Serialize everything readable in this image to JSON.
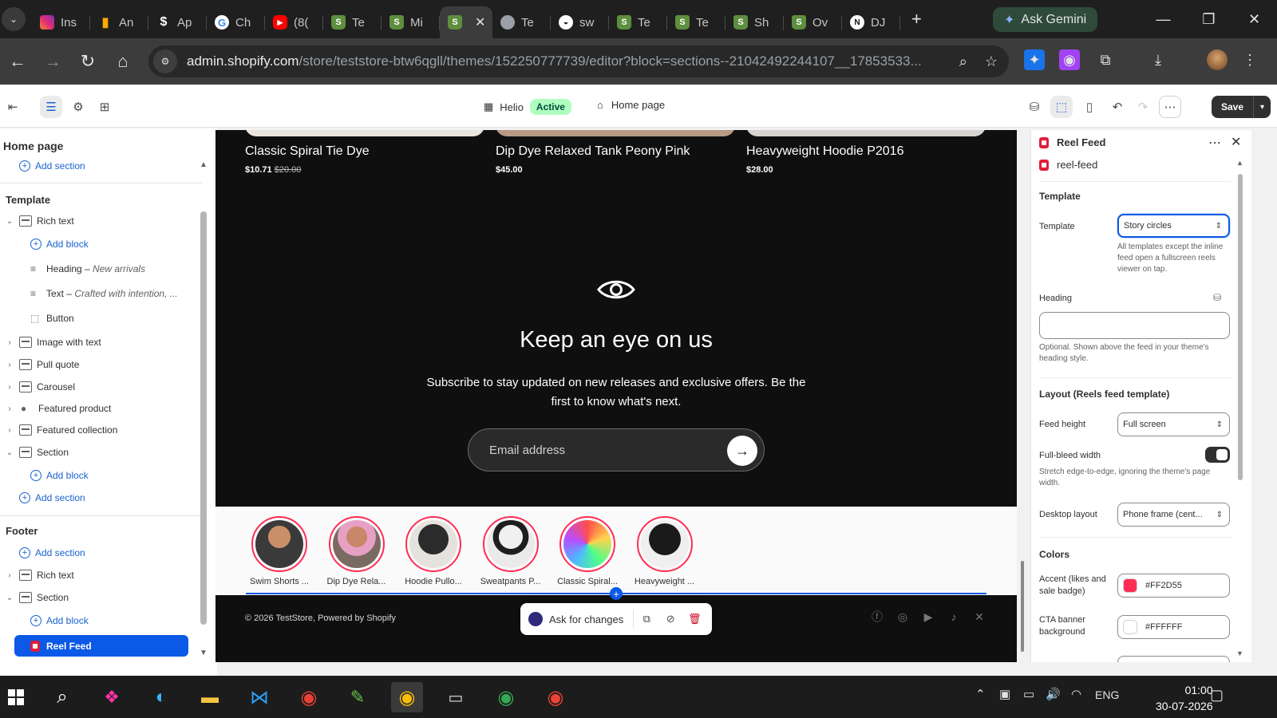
{
  "browser": {
    "tabs": [
      {
        "label": "Ins",
        "icon": "instagram-icon"
      },
      {
        "label": "An",
        "icon": "analytics-icon"
      },
      {
        "label": "Ap",
        "icon": "apps-icon"
      },
      {
        "label": "Ch",
        "icon": "google-icon"
      },
      {
        "label": "(8(",
        "icon": "youtube-icon"
      },
      {
        "label": "Te",
        "icon": "shopify-icon"
      },
      {
        "label": "Mi",
        "icon": "shopify-icon"
      },
      {
        "label": "",
        "icon": "shopify-icon",
        "active": true
      },
      {
        "label": "Te",
        "icon": "globe-icon"
      },
      {
        "label": "sw",
        "icon": "swirl-icon"
      },
      {
        "label": "Te",
        "icon": "shopify-icon"
      },
      {
        "label": "Te",
        "icon": "shopify-icon"
      },
      {
        "label": "Sh",
        "icon": "shopify-icon"
      },
      {
        "label": "Ov",
        "icon": "shopify-icon"
      },
      {
        "label": "DJ",
        "icon": "dj-icon"
      }
    ],
    "gemini_label": "Ask Gemini",
    "url_host": "admin.shopify.com",
    "url_path": "/store/teststore-btw6qgll/themes/152250777739/editor?block=sections--21042492244107__17853533..."
  },
  "editor": {
    "theme_name": "Helio",
    "theme_status": "Active",
    "page_selector": "Home page",
    "save_label": "Save"
  },
  "sidebar": {
    "title": "Home page",
    "add_section_top": "Add section",
    "template_title": "Template",
    "template_items": [
      {
        "label": "Rich text",
        "indent": 0,
        "kind": "section",
        "expanded": true
      },
      {
        "label": "Add block",
        "indent": 1,
        "kind": "add"
      },
      {
        "label": "Heading",
        "detail": "New arrivals",
        "indent": 1,
        "kind": "block"
      },
      {
        "label": "Text",
        "detail": "Crafted with intention, ...",
        "indent": 1,
        "kind": "block"
      },
      {
        "label": "Button",
        "indent": 1,
        "kind": "button"
      },
      {
        "label": "Image with text",
        "indent": 0,
        "kind": "section"
      },
      {
        "label": "Pull quote",
        "indent": 0,
        "kind": "section"
      },
      {
        "label": "Carousel",
        "indent": 0,
        "kind": "section"
      },
      {
        "label": "Featured product",
        "indent": 0,
        "kind": "product"
      },
      {
        "label": "Featured collection",
        "indent": 0,
        "kind": "section"
      },
      {
        "label": "Section",
        "indent": 0,
        "kind": "section",
        "expanded": true
      },
      {
        "label": "Add block",
        "indent": 1,
        "kind": "add"
      },
      {
        "label": "Add section",
        "indent": 0,
        "kind": "add"
      }
    ],
    "footer_title": "Footer",
    "footer_items": [
      {
        "label": "Add section",
        "indent": 0,
        "kind": "add"
      },
      {
        "label": "Rich text",
        "indent": 0,
        "kind": "section"
      },
      {
        "label": "Section",
        "indent": 0,
        "kind": "section",
        "expanded": true
      },
      {
        "label": "Add block",
        "indent": 1,
        "kind": "add"
      }
    ],
    "selected_item": "Reel Feed"
  },
  "preview": {
    "products": [
      {
        "title": "Classic Spiral Tie Dye",
        "price": "$10.71",
        "compare_price": "$20.00"
      },
      {
        "title": "Dip Dye Relaxed Tank Peony Pink",
        "price": "$45.00",
        "compare_price": ""
      },
      {
        "title": "Heavyweight Hoodie P2016",
        "price": "$28.00",
        "compare_price": ""
      }
    ],
    "newsletter_title": "Keep an eye on us",
    "newsletter_text": "Subscribe to stay updated on new releases and exclusive offers. Be the first to know what's next.",
    "email_placeholder": "Email address",
    "reels": [
      {
        "label": "Swim Shorts ..."
      },
      {
        "label": "Dip Dye Rela..."
      },
      {
        "label": "Hoodie Pullo..."
      },
      {
        "label": "Sweatpants P..."
      },
      {
        "label": "Classic Spiral..."
      },
      {
        "label": "Heavyweight ..."
      }
    ],
    "footer_copyright": "© 2026 TestStore, Powered by Shopify",
    "ask_label": "Ask for changes"
  },
  "settings": {
    "block_title": "Reel Feed",
    "block_handle": "reel-feed",
    "template_section": "Template",
    "template_label": "Template",
    "template_value": "Story circles",
    "template_help": "All templates except the inline feed open a fullscreen reels viewer on tap.",
    "heading_label": "Heading",
    "heading_value": "",
    "heading_help": "Optional. Shown above the feed in your theme's heading style.",
    "layout_section": "Layout (Reels feed template)",
    "feed_height_label": "Feed height",
    "feed_height_value": "Full screen",
    "full_bleed_label": "Full-bleed width",
    "full_bleed_on": true,
    "full_bleed_help": "Stretch edge-to-edge, ignoring the theme's page width.",
    "desktop_layout_label": "Desktop layout",
    "desktop_layout_value": "Phone frame (cent...",
    "colors_section": "Colors",
    "accent_label": "Accent (likes and sale badge)",
    "accent_value": "#FF2D55",
    "cta_bg_label": "CTA banner background",
    "cta_bg_value": "#FFFFFF"
  },
  "taskbar": {
    "lang": "ENG",
    "time": "01:00",
    "date": "30-07-2026"
  }
}
